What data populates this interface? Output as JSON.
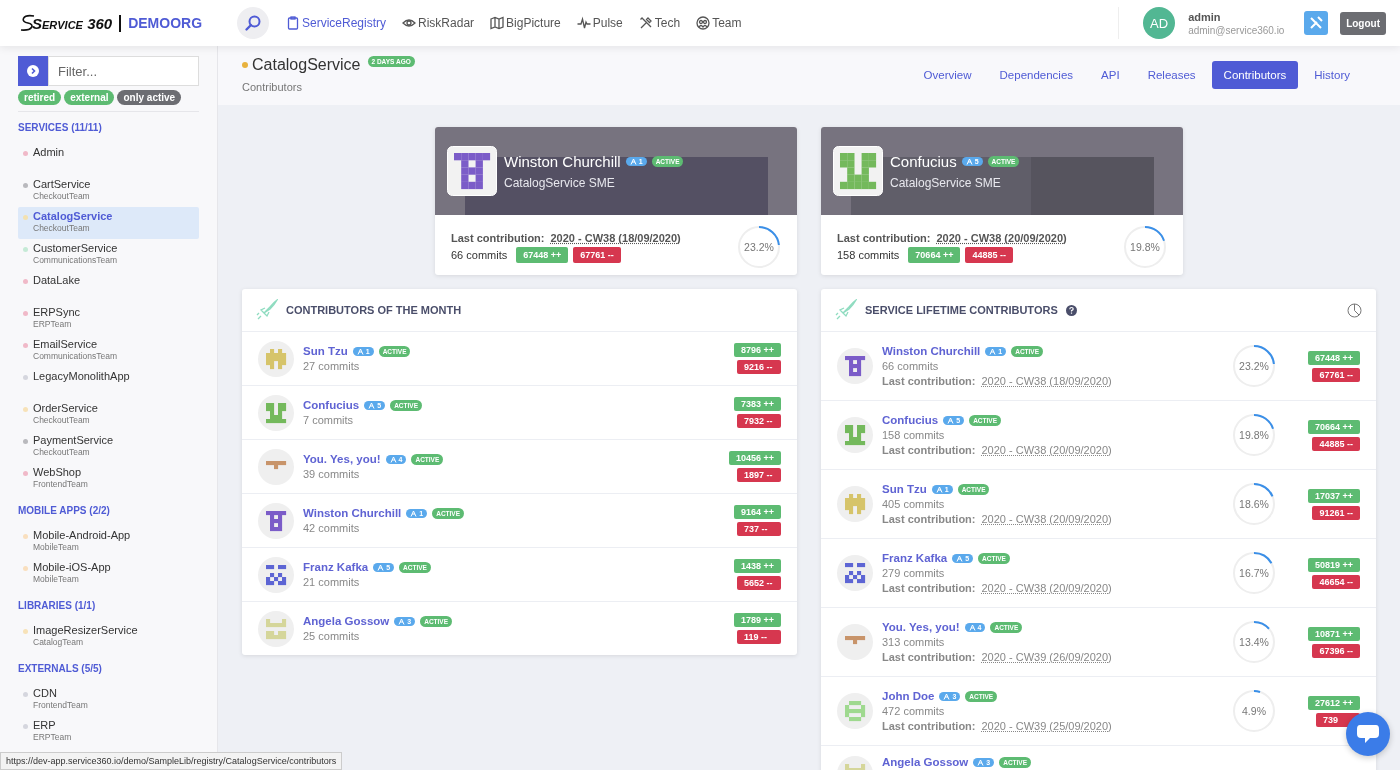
{
  "header": {
    "logo": "Service 360",
    "org": "DEMOORG",
    "nav": [
      {
        "label": "ServiceRegistry",
        "selected": true
      },
      {
        "label": "RiskRadar",
        "selected": false
      },
      {
        "label": "BigPicture",
        "selected": false
      },
      {
        "label": "Pulse",
        "selected": false
      },
      {
        "label": "Tech",
        "selected": false
      },
      {
        "label": "Team",
        "selected": false
      }
    ],
    "user": {
      "initials": "AD",
      "name": "admin",
      "email": "admin@service360.io"
    },
    "logout": "Logout"
  },
  "sidebar": {
    "filter": {
      "placeholder": "Filter..."
    },
    "tags": [
      {
        "label": "retired",
        "selected": true
      },
      {
        "label": "external",
        "selected": true
      },
      {
        "label": "only active",
        "selected": false
      }
    ],
    "sections": [
      {
        "title": "SERVICES (11/11)",
        "items": [
          {
            "name": "Admin",
            "color": "#f0b9c8",
            "selected": false
          },
          {
            "name": "CartService",
            "team": "CheckoutTeam",
            "color": "#b9b9bd",
            "selected": false
          },
          {
            "name": "CatalogService",
            "team": "CheckoutTeam",
            "color": "#f3e1b0",
            "selected": true
          },
          {
            "name": "CustomerService",
            "team": "CommunicationsTeam",
            "color": "#c5ead6",
            "selected": false
          },
          {
            "name": "DataLake",
            "color": "#f0b9c8",
            "selected": false
          },
          {
            "name": "ERPSync",
            "team": "ERPTeam",
            "color": "#f0b9c8",
            "selected": false
          },
          {
            "name": "EmailService",
            "team": "CommunicationsTeam",
            "color": "#f0b9c8",
            "selected": false
          },
          {
            "name": "LegacyMonolithApp",
            "color": "#d5d6de",
            "selected": false
          },
          {
            "name": "OrderService",
            "team": "CheckoutTeam",
            "color": "#f7e2b8",
            "selected": false
          },
          {
            "name": "PaymentService",
            "team": "CheckoutTeam",
            "color": "#b9b9bd",
            "selected": false
          },
          {
            "name": "WebShop",
            "team": "FrontendTeam",
            "color": "#f0b9c8",
            "selected": false
          }
        ]
      },
      {
        "title": "MOBILE APPS (2/2)",
        "items": [
          {
            "name": "Mobile-Android-App",
            "team": "MobileTeam",
            "color": "#f9dfbe",
            "selected": false
          },
          {
            "name": "Mobile-iOS-App",
            "team": "MobileTeam",
            "color": "#f9dfbe",
            "selected": false
          }
        ]
      },
      {
        "title": "LIBRARIES (1/1)",
        "items": [
          {
            "name": "ImageResizerService",
            "team": "CatalogTeam",
            "color": "#f7e2b8",
            "selected": false
          }
        ]
      },
      {
        "title": "EXTERNALS (5/5)",
        "items": [
          {
            "name": "CDN",
            "team": "FrontendTeam",
            "color": "#d5d6de",
            "selected": false
          },
          {
            "name": "ERP",
            "team": "ERPTeam",
            "color": "#d5d6de",
            "selected": false
          }
        ]
      }
    ]
  },
  "page": {
    "title": "CatalogService",
    "color": "#e8b23e",
    "age": "2 DAYS AGO",
    "subtitle": "Contributors",
    "tabs": [
      {
        "label": "Overview",
        "selected": false
      },
      {
        "label": "Dependencies",
        "selected": false
      },
      {
        "label": "API",
        "selected": false
      },
      {
        "label": "Releases",
        "selected": false
      },
      {
        "label": "Contributors",
        "selected": true
      },
      {
        "label": "History",
        "selected": false
      }
    ]
  },
  "smes": [
    {
      "name": "Winston Churchill",
      "rank": "1",
      "status": "ACTIVE",
      "role": "CatalogService SME",
      "kind": "tower",
      "color": "#7b5cc8",
      "last_label": "Last contribution:",
      "last_date": "2020 - CW38 (18/09/2020)",
      "commits": "66 commits",
      "added": "67448 ++",
      "removed": "67761 --",
      "reading": "23.2%",
      "level": 0.232
    },
    {
      "name": "Confucius",
      "rank": "5",
      "status": "ACTIVE",
      "role": "CatalogService SME",
      "kind": "cup",
      "color": "#74b95c",
      "last_label": "Last contribution:",
      "last_date": "2020 - CW38 (20/09/2020)",
      "commits": "158 commits",
      "added": "70664 ++",
      "removed": "44885 --",
      "reading": "19.8%",
      "level": 0.198
    }
  ],
  "month": {
    "title": "CONTRIBUTORS OF THE MONTH",
    "rows": [
      {
        "name": "Sun Tzu",
        "rank": "1",
        "status": "ACTIVE",
        "kind": "house",
        "color": "#d6c46a",
        "commits": "27 commits",
        "added": "8796 ++",
        "removed": "9216 --"
      },
      {
        "name": "Confucius",
        "rank": "5",
        "status": "ACTIVE",
        "kind": "cup",
        "color": "#74b95c",
        "commits": "7 commits",
        "added": "7383 ++",
        "removed": "7932 --"
      },
      {
        "name": "You. Yes, you!",
        "rank": "4",
        "status": "ACTIVE",
        "kind": "table",
        "color": "#c8946a",
        "commits": "39 commits",
        "added": "10456 ++",
        "removed": "1897 --"
      },
      {
        "name": "Winston Churchill",
        "rank": "1",
        "status": "ACTIVE",
        "kind": "tower",
        "color": "#7b5cc8",
        "commits": "42 commits",
        "added": "9164 ++",
        "removed": "737 --"
      },
      {
        "name": "Franz Kafka",
        "rank": "5",
        "status": "ACTIVE",
        "kind": "cross",
        "color": "#5d65d4",
        "commits": "21 commits",
        "added": "1438 ++",
        "removed": "5652 --"
      },
      {
        "name": "Angela Gossow",
        "rank": "3",
        "status": "ACTIVE",
        "kind": "bench",
        "color": "#d5d69a",
        "commits": "25 commits",
        "added": "1789 ++",
        "removed": "119 --"
      }
    ]
  },
  "lifetime": {
    "title": "SERVICE LIFETIME CONTRIBUTORS",
    "rows": [
      {
        "name": "Winston Churchill",
        "rank": "1",
        "status": "ACTIVE",
        "kind": "tower",
        "color": "#7b5cc8",
        "commits": "66 commits",
        "last_label": "Last contribution:",
        "last_date": "2020 - CW38 (18/09/2020)",
        "reading": "23.2%",
        "level": 0.232,
        "added": "67448 ++",
        "removed": "67761 --"
      },
      {
        "name": "Confucius",
        "rank": "5",
        "status": "ACTIVE",
        "kind": "cup",
        "color": "#74b95c",
        "commits": "158 commits",
        "last_label": "Last contribution:",
        "last_date": "2020 - CW38 (20/09/2020)",
        "reading": "19.8%",
        "level": 0.198,
        "added": "70664 ++",
        "removed": "44885 --"
      },
      {
        "name": "Sun Tzu",
        "rank": "1",
        "status": "ACTIVE",
        "kind": "house",
        "color": "#d6c46a",
        "commits": "405 commits",
        "last_label": "Last contribution:",
        "last_date": "2020 - CW38 (20/09/2020)",
        "reading": "18.6%",
        "level": 0.186,
        "added": "17037 ++",
        "removed": "91261 --"
      },
      {
        "name": "Franz Kafka",
        "rank": "5",
        "status": "ACTIVE",
        "kind": "cross",
        "color": "#5d65d4",
        "commits": "279 commits",
        "last_label": "Last contribution:",
        "last_date": "2020 - CW38 (20/09/2020)",
        "reading": "16.7%",
        "level": 0.167,
        "added": "50819 ++",
        "removed": "46654 --"
      },
      {
        "name": "You. Yes, you!",
        "rank": "4",
        "status": "ACTIVE",
        "kind": "table",
        "color": "#c8946a",
        "commits": "313 commits",
        "last_label": "Last contribution:",
        "last_date": "2020 - CW39 (26/09/2020)",
        "reading": "13.4%",
        "level": 0.134,
        "added": "10871 ++",
        "removed": "67396 --"
      },
      {
        "name": "John Doe",
        "rank": "3",
        "status": "ACTIVE",
        "kind": "grid",
        "color": "#9fd98f",
        "commits": "472 commits",
        "last_label": "Last contribution:",
        "last_date": "2020 - CW39 (25/09/2020)",
        "reading": "4.9%",
        "level": 0.049,
        "added": "27612 ++",
        "removed": "739"
      },
      {
        "name": "Angela Gossow",
        "rank": "3",
        "status": "ACTIVE",
        "kind": "bench",
        "color": "#d5d69a"
      }
    ]
  },
  "status_bar": "https://dev-app.service360.io/demo/SampleLib/registry/CatalogService/contributors"
}
